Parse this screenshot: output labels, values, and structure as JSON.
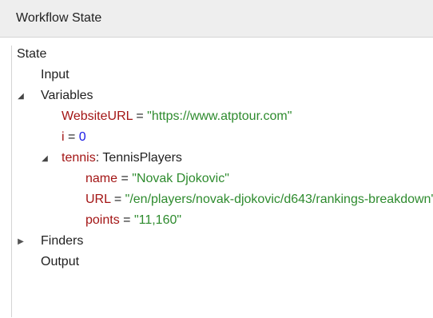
{
  "panel": {
    "title": "Workflow State"
  },
  "tree": {
    "root_label": "State",
    "input_label": "Input",
    "variables": {
      "label": "Variables",
      "expanded": true,
      "website_url": {
        "name": "WebsiteURL",
        "eq": " = ",
        "value": "\"https://www.atptour.com\""
      },
      "i": {
        "name": "i",
        "eq": " = ",
        "value": "0"
      },
      "tennis": {
        "name": "tennis",
        "sep": ": ",
        "type": "TennisPlayers",
        "expanded": true,
        "name_field": {
          "name": "name",
          "eq": " = ",
          "value": "\"Novak Djokovic\""
        },
        "url_field": {
          "name": "URL",
          "eq": " = ",
          "value": "\"/en/players/novak-djokovic/d643/rankings-breakdown\""
        },
        "points_field": {
          "name": "points",
          "eq": " = ",
          "value": "\"11,160\""
        }
      }
    },
    "finders_label": "Finders",
    "output_label": "Output"
  },
  "icons": {
    "expanded": "triangle-expanded-icon",
    "collapsed": "triangle-collapsed-icon"
  },
  "colors": {
    "variable_name": "#a31515",
    "string_value": "#2e8b2e",
    "number_value": "#1a1ae6",
    "header_bg": "#eeeeee"
  }
}
